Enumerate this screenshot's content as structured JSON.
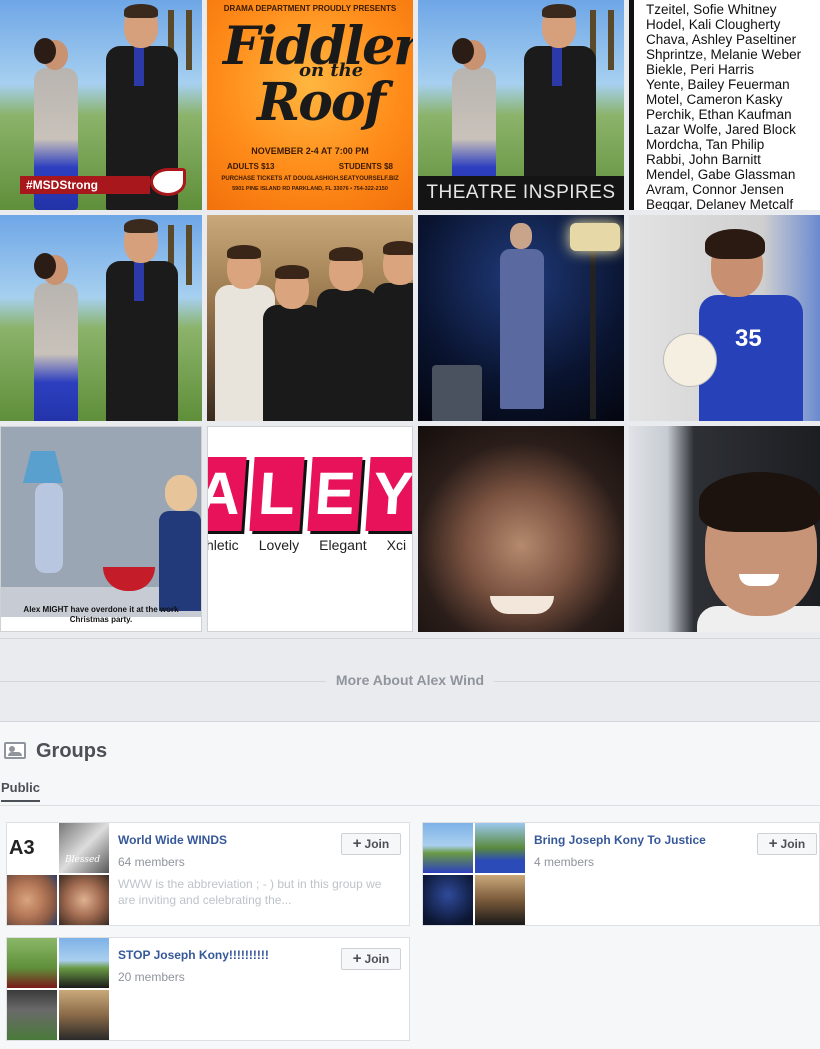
{
  "photos": {
    "fiddler": {
      "dept": "DRAMA DEPARTMENT PROUDLY PRESENTS",
      "title_a": "Fiddler",
      "title_b": "on the",
      "title_c": "Roof",
      "date": "NOVEMBER 2-4 AT 7:00 PM",
      "adults": "ADULTS $13",
      "students": "STUDENTS $8",
      "buy": "PURCHASE TICKETS AT DOUGLASHIGH.SEATYOURSELF.BIZ",
      "addr": "5901 PINE ISLAND RD PARKLAND, FL 33076 • 754-322-2150"
    },
    "msd_badge": "#MSDStrong",
    "theatre_badge": "THEATRE INSPIRES",
    "cast_list": [
      "Tzeitel, Sofie Whitney",
      "Hodel, Kali Clougherty",
      "Chava, Ashley Paseltiner",
      "Shprintze, Melanie Weber",
      "Biekle, Peri Harris",
      "Yente, Bailey Feuerman",
      "Motel, Cameron Kasky",
      "Perchik, Ethan Kaufman",
      "Lazar Wolfe, Jared Block",
      "Mordcha, Tan Philip",
      "Rabbi, John Barnitt",
      "Mendel, Gabe Glassman",
      "Avram, Connor Jensen",
      "Beggar, Delaney Metcalf"
    ],
    "jersey_number": "35",
    "cartoon_caption": "Alex MIGHT have overdone it at the work Christmas party.",
    "alex_letters": [
      "A",
      "L",
      "E",
      "Y"
    ],
    "alex_words": [
      "hletic",
      "Lovely",
      "Elegant",
      "Xci"
    ]
  },
  "more_about": "More About Alex Wind",
  "groups": {
    "title": "Groups",
    "tab": "Public",
    "join_label": "Join",
    "items": [
      {
        "name": "World Wide WINDS",
        "members": "64 members",
        "description": "WWW is the abbreviation ; - ) but in this group we are inviting and celebrating the..."
      },
      {
        "name": "Bring Joseph Kony To Justice",
        "members": "4 members",
        "description": ""
      },
      {
        "name": "STOP Joseph Kony!!!!!!!!!!",
        "members": "20 members",
        "description": ""
      }
    ],
    "thumb_text": {
      "a3": "A3",
      "blessed": "Blessed"
    }
  },
  "colors": {
    "link": "#365899",
    "muted": "#90949c",
    "page_bg": "#e9ebee",
    "msd_red": "#a8171c",
    "alex_pink": "#e8125a"
  }
}
